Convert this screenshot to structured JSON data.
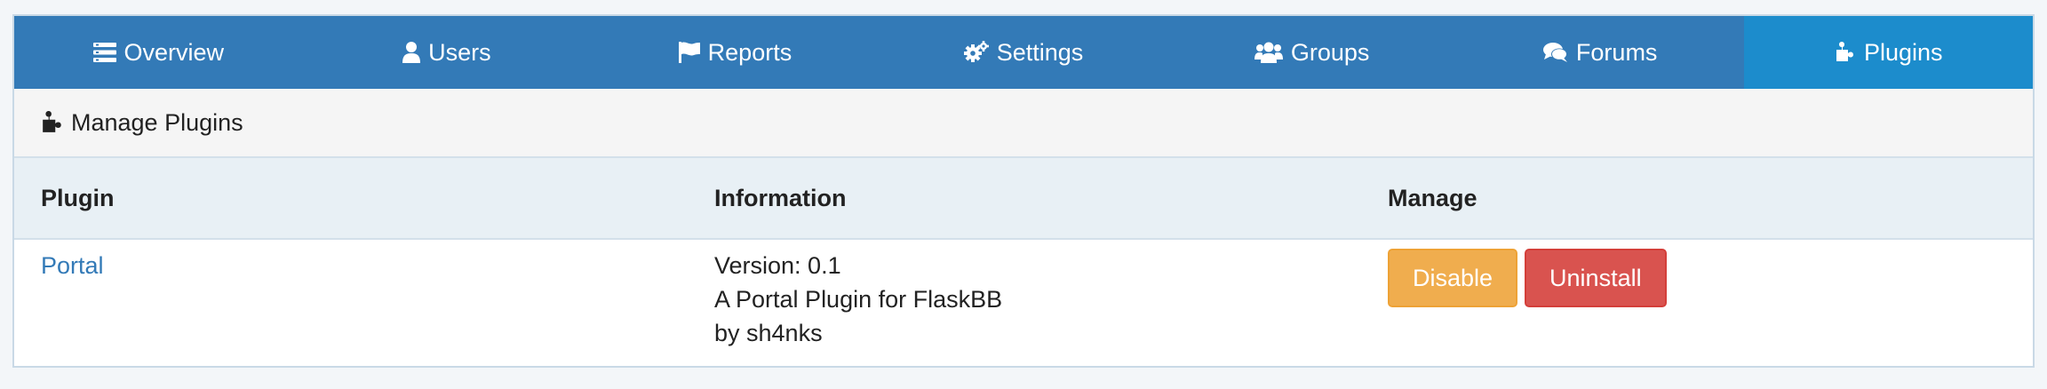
{
  "nav": {
    "items": [
      {
        "label": "Overview",
        "icon": "list-icon"
      },
      {
        "label": "Users",
        "icon": "user-icon"
      },
      {
        "label": "Reports",
        "icon": "flag-icon"
      },
      {
        "label": "Settings",
        "icon": "gears-icon"
      },
      {
        "label": "Groups",
        "icon": "users-icon"
      },
      {
        "label": "Forums",
        "icon": "comments-icon"
      },
      {
        "label": "Plugins",
        "icon": "puzzle-icon",
        "active": true
      }
    ]
  },
  "panel": {
    "title": "Manage Plugins",
    "icon": "puzzle-icon"
  },
  "table": {
    "headers": [
      "Plugin",
      "Information",
      "Manage"
    ],
    "rows": [
      {
        "name": "Portal",
        "version": "Version: 0.1",
        "description": "A Portal Plugin for FlaskBB",
        "author": "by sh4nks",
        "actions": {
          "disable": "Disable",
          "uninstall": "Uninstall"
        }
      }
    ]
  },
  "colors": {
    "navbar": "#337ab7",
    "nav_active": "#1c8ccc",
    "link": "#337ab7",
    "warning": "#f0ad4e",
    "danger": "#d9534f"
  }
}
